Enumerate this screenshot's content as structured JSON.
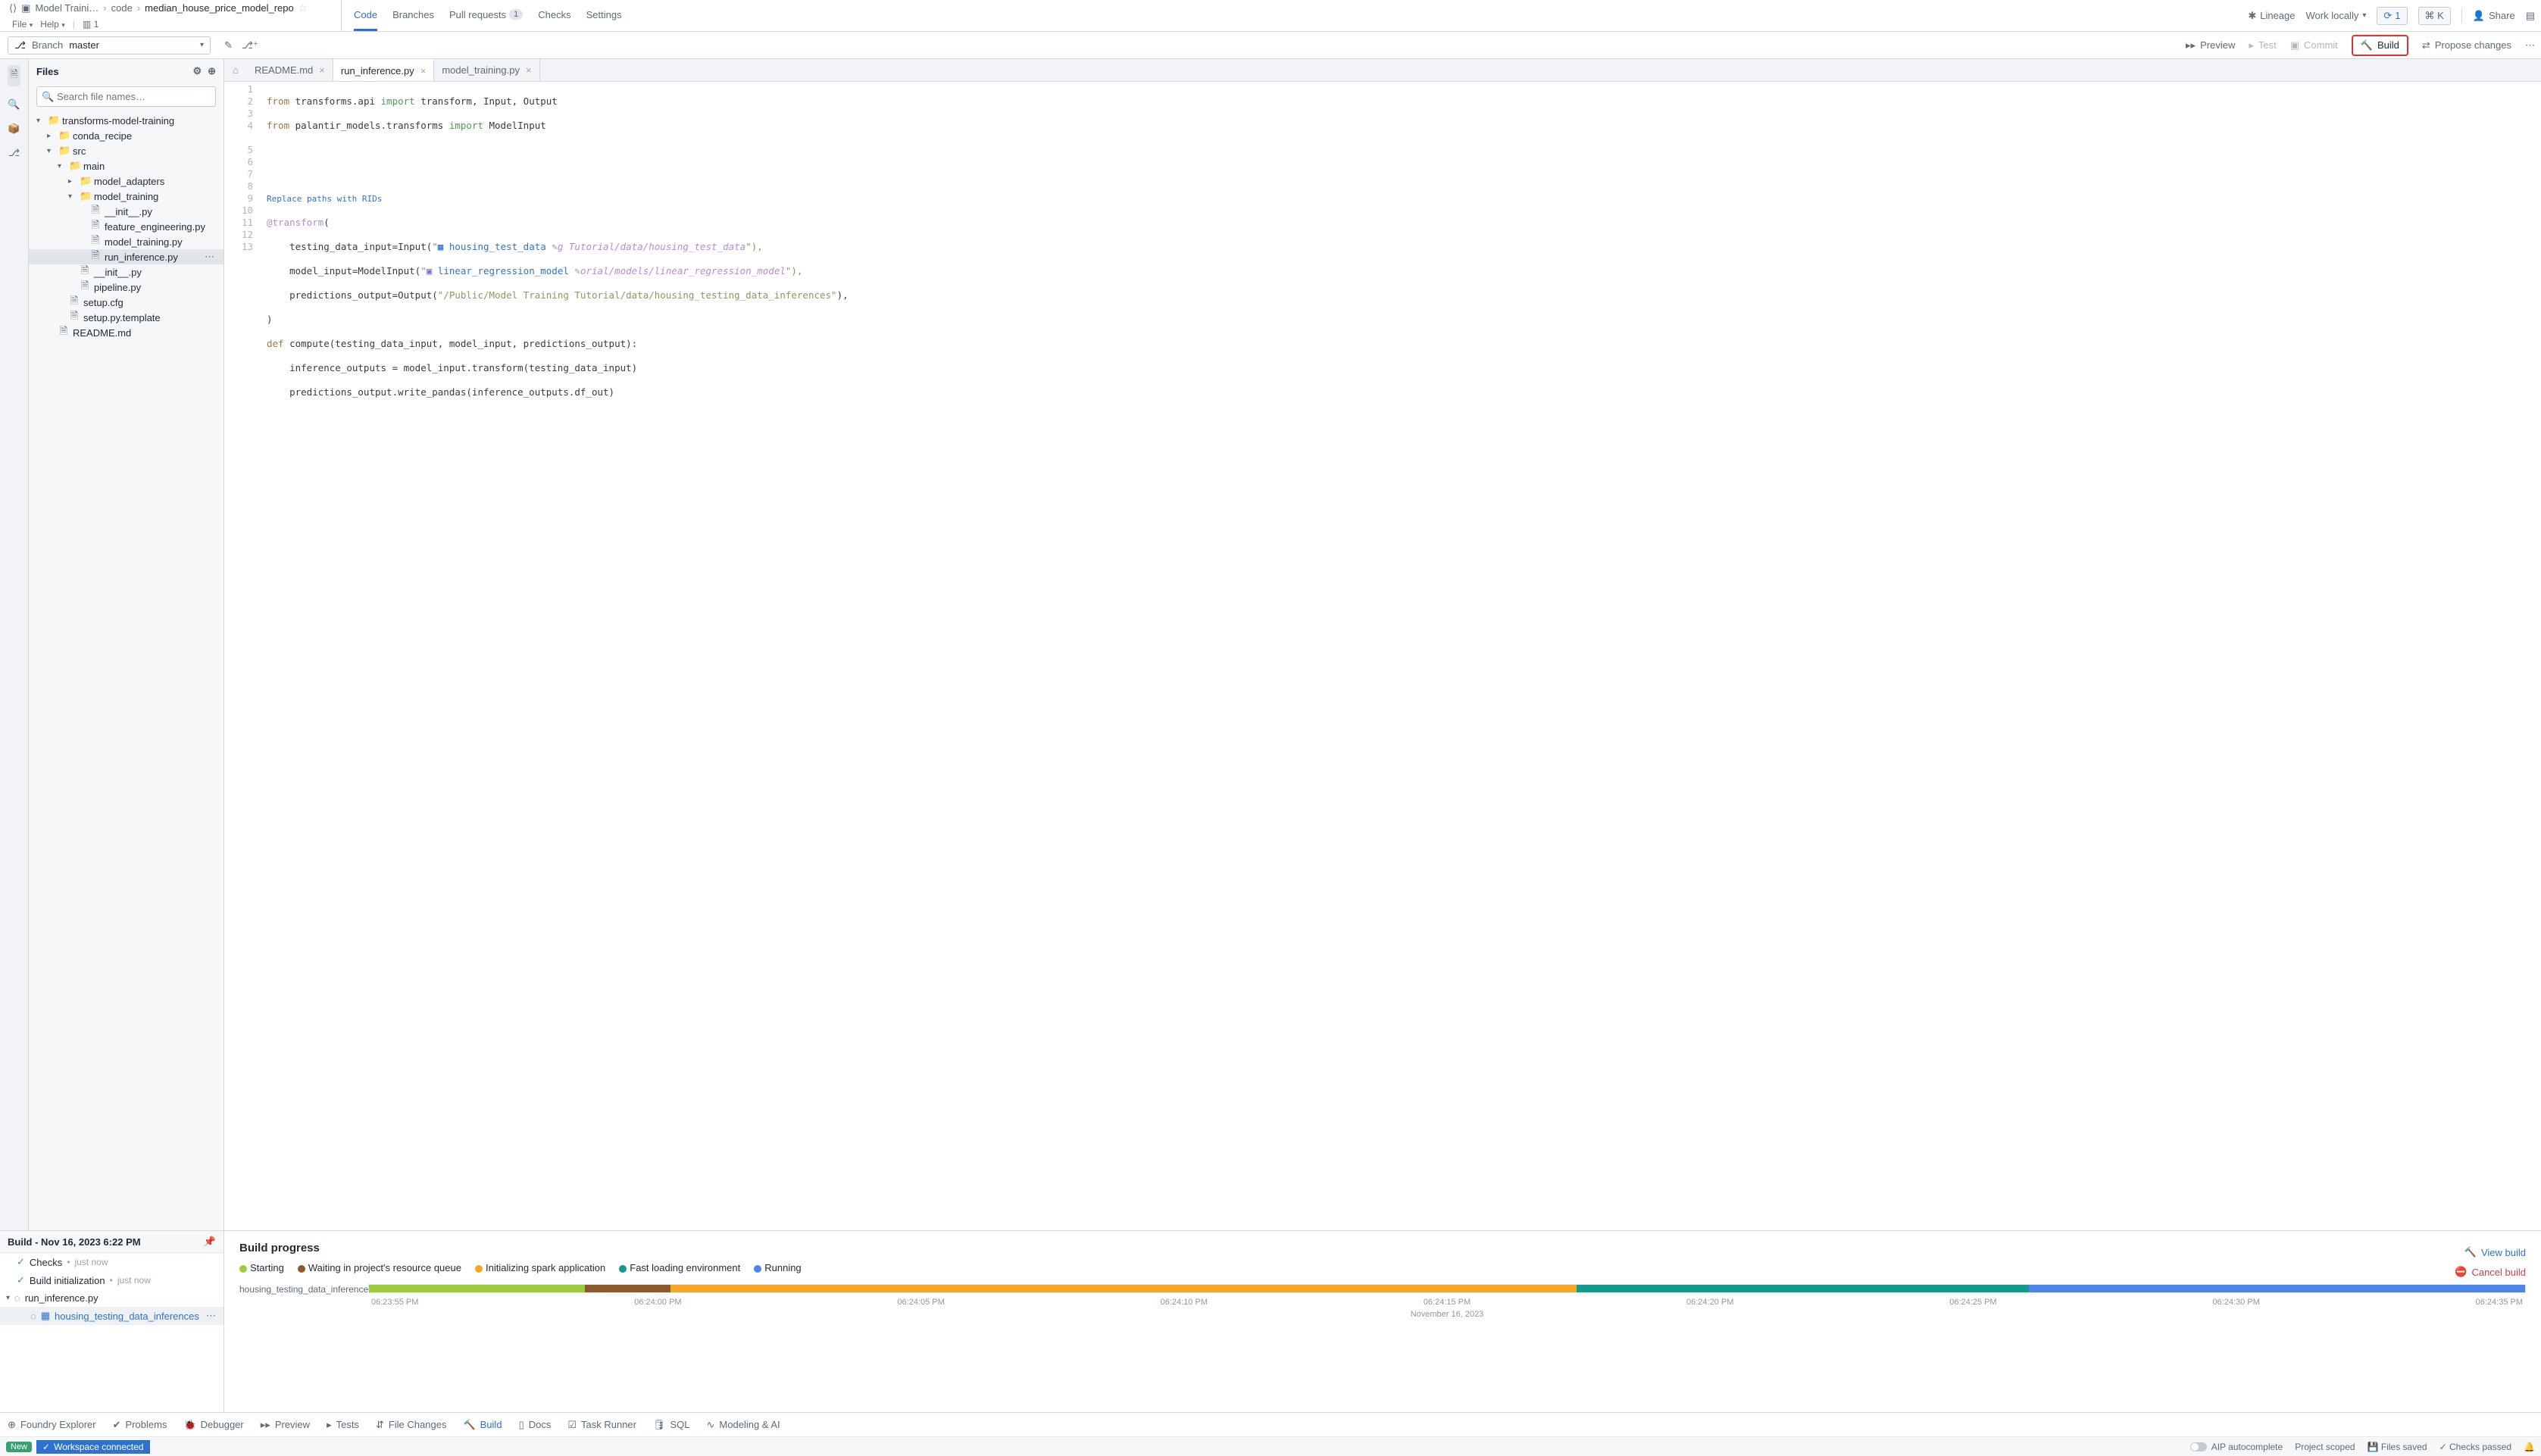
{
  "header": {
    "breadcrumb": {
      "root": "Model Traini…",
      "folder": "code",
      "repo": "median_house_price_model_repo"
    },
    "menu": {
      "file": "File",
      "help": "Help",
      "collab_count": "1"
    },
    "tabs": {
      "code": "Code",
      "branches": "Branches",
      "pull_requests": "Pull requests",
      "pr_count": "1",
      "checks": "Checks",
      "settings": "Settings"
    },
    "right": {
      "lineage": "Lineage",
      "work_locally": "Work locally",
      "refresh_count": "1",
      "shortcut": "⌘ K",
      "share": "Share"
    }
  },
  "branchbar": {
    "label": "Branch",
    "branch": "master",
    "actions": {
      "preview": "Preview",
      "test": "Test",
      "commit": "Commit",
      "build": "Build",
      "propose": "Propose changes"
    }
  },
  "sidebar": {
    "title": "Files",
    "search_placeholder": "Search file names…",
    "tree": {
      "root": "transforms-model-training",
      "conda": "conda_recipe",
      "src": "src",
      "main": "main",
      "model_adapters": "model_adapters",
      "model_training": "model_training",
      "init_inner": "__init__.py",
      "feature_eng": "feature_engineering.py",
      "model_training_py": "model_training.py",
      "run_inference": "run_inference.py",
      "init_outer": "__init__.py",
      "pipeline": "pipeline.py",
      "setup_cfg": "setup.cfg",
      "setup_tpl": "setup.py.template",
      "readme": "README.md"
    }
  },
  "editor_tabs": {
    "readme": "README.md",
    "run_inference": "run_inference.py",
    "model_training": "model_training.py"
  },
  "code": {
    "replace_note": "Replace paths with RIDs",
    "l1a": "from",
    "l1b": " transforms.api ",
    "l1c": "import",
    "l1d": " transform, Input, Output",
    "l2a": "from",
    "l2b": " palantir_models.transforms ",
    "l2c": "import",
    "l2d": " ModelInput",
    "l5a": "@transform",
    "l5b": "(",
    "l6a": "    testing_data_input=Input(",
    "l6b": "\"",
    "l6link": "housing_test_data",
    "l6hint": "g Tutorial/data/housing_test_data",
    "l6c": "\"),",
    "l7a": "    model_input=ModelInput(",
    "l7b": "\"",
    "l7link": "linear_regression_model",
    "l7hint": "orial/models/linear_regression_model",
    "l7c": "\"),",
    "l8a": "    predictions_output=Output(",
    "l8b": "\"/Public/Model Training Tutorial/data/housing_testing_data_inferences\"",
    "l8c": "),",
    "l9": ")",
    "l10a": "def",
    "l10b": " compute(testing_data_input, model_input, predictions_output):",
    "l11": "    inference_outputs = model_input.transform(testing_data_input)",
    "l12": "    predictions_output.write_pandas(inference_outputs.df_out)"
  },
  "build_left": {
    "title": "Build - Nov 16, 2023 6:22 PM",
    "checks": "Checks",
    "just_now": "just now",
    "build_init": "Build initialization",
    "run_inf": "run_inference.py",
    "dataset": "housing_testing_data_inferences"
  },
  "build_right": {
    "title": "Build progress",
    "legend": {
      "starting": "Starting",
      "waiting": "Waiting in project's resource queue",
      "init_spark": "Initializing spark application",
      "fast_env": "Fast loading environment",
      "running": "Running"
    },
    "colors": {
      "starting": "#9ccb3b",
      "waiting": "#8a5a2b",
      "init_spark": "#f5a623",
      "fast_env": "#0f9b8f",
      "running": "#4a86e8"
    },
    "view_build": "View build",
    "cancel_build": "Cancel build",
    "row_label": "housing_testing_data_inferences",
    "ticks": [
      "06:23:55 PM",
      "06:24:00 PM",
      "06:24:05 PM",
      "06:24:10 PM",
      "06:24:15 PM",
      "06:24:20 PM",
      "06:24:25 PM",
      "06:24:30 PM",
      "06:24:35 PM"
    ],
    "date": "November 16, 2023"
  },
  "footer1": {
    "foundry": "Foundry Explorer",
    "problems": "Problems",
    "debugger": "Debugger",
    "preview": "Preview",
    "tests": "Tests",
    "file_changes": "File Changes",
    "build": "Build",
    "docs": "Docs",
    "task_runner": "Task Runner",
    "sql": "SQL",
    "modeling": "Modeling & AI"
  },
  "footer2": {
    "new": "New",
    "workspace": "Workspace connected",
    "aip": "AIP autocomplete",
    "project_scoped": "Project scoped",
    "files_saved": "Files saved",
    "checks_passed": "Checks passed"
  },
  "chart_data": {
    "type": "bar",
    "title": "Build progress",
    "categories": [
      "housing_testing_data_inferences"
    ],
    "x_ticks": [
      "06:23:55 PM",
      "06:24:00 PM",
      "06:24:05 PM",
      "06:24:10 PM",
      "06:24:15 PM",
      "06:24:20 PM",
      "06:24:25 PM",
      "06:24:30 PM",
      "06:24:35 PM"
    ],
    "series": [
      {
        "name": "Starting",
        "color": "#9ccb3b",
        "start": "06:23:55 PM",
        "end": "06:24:00 PM",
        "pct": 10
      },
      {
        "name": "Waiting in project's resource queue",
        "color": "#8a5a2b",
        "start": "06:24:00 PM",
        "end": "06:24:02 PM",
        "pct": 4
      },
      {
        "name": "Initializing spark application",
        "color": "#f5a623",
        "start": "06:24:02 PM",
        "end": "06:24:20 PM",
        "pct": 42
      },
      {
        "name": "Fast loading environment",
        "color": "#0f9b8f",
        "start": "06:24:20 PM",
        "end": "06:24:29 PM",
        "pct": 21
      },
      {
        "name": "Running",
        "color": "#4a86e8",
        "start": "06:24:29 PM",
        "end": "06:24:37 PM",
        "pct": 23
      }
    ],
    "xlabel": "November 16, 2023"
  }
}
